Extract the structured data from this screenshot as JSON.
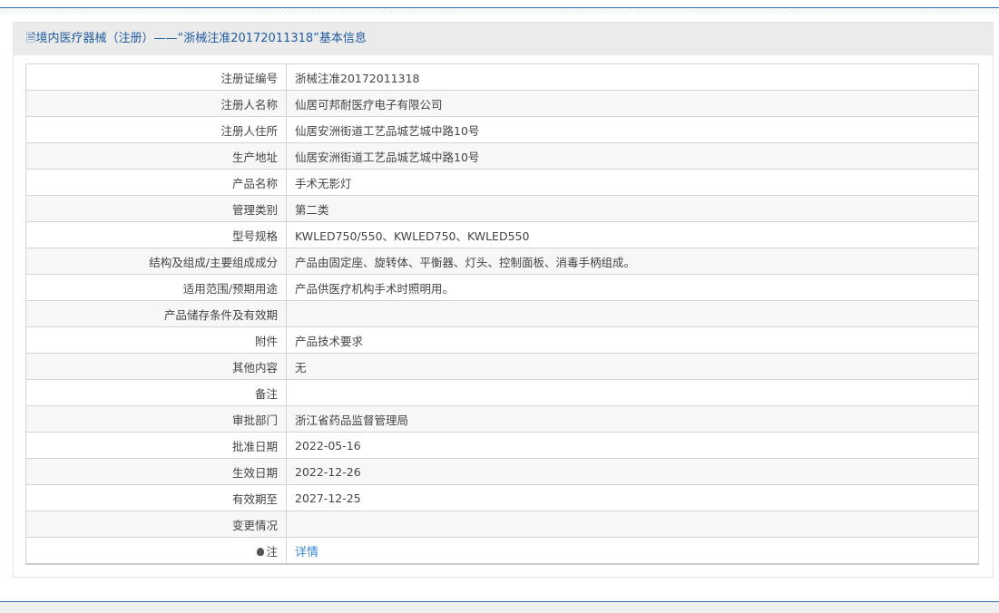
{
  "header": {
    "title": "境内医疗器械（注册）——“浙械注准20172011318”基本信息",
    "icon": "document-icon"
  },
  "rows": [
    {
      "label": "注册证编号",
      "value": "浙械注准20172011318"
    },
    {
      "label": "注册人名称",
      "value": "仙居可邦耐医疗电子有限公司"
    },
    {
      "label": "注册人住所",
      "value": "仙居安洲街道工艺品城艺城中路10号"
    },
    {
      "label": "生产地址",
      "value": "仙居安洲街道工艺品城艺城中路10号"
    },
    {
      "label": "产品名称",
      "value": "手术无影灯"
    },
    {
      "label": "管理类别",
      "value": "第二类"
    },
    {
      "label": "型号规格",
      "value": "KWLED750/550、KWLED750、KWLED550"
    },
    {
      "label": "结构及组成/主要组成成分",
      "value": "产品由固定座、旋转体、平衡器、灯头、控制面板、消毒手柄组成。"
    },
    {
      "label": "适用范围/预期用途",
      "value": "产品供医疗机构手术时照明用。"
    },
    {
      "label": "产品储存条件及有效期",
      "value": ""
    },
    {
      "label": "附件",
      "value": "产品技术要求"
    },
    {
      "label": "其他内容",
      "value": "无"
    },
    {
      "label": "备注",
      "value": ""
    },
    {
      "label": "审批部门",
      "value": "浙江省药品监督管理局"
    },
    {
      "label": "批准日期",
      "value": "2022-05-16"
    },
    {
      "label": "生效日期",
      "value": "2022-12-26"
    },
    {
      "label": "有效期至",
      "value": "2027-12-25"
    },
    {
      "label": "变更情况",
      "value": ""
    }
  ],
  "note": {
    "label": "注",
    "link": "详情",
    "icon": "lightbulb-icon"
  }
}
